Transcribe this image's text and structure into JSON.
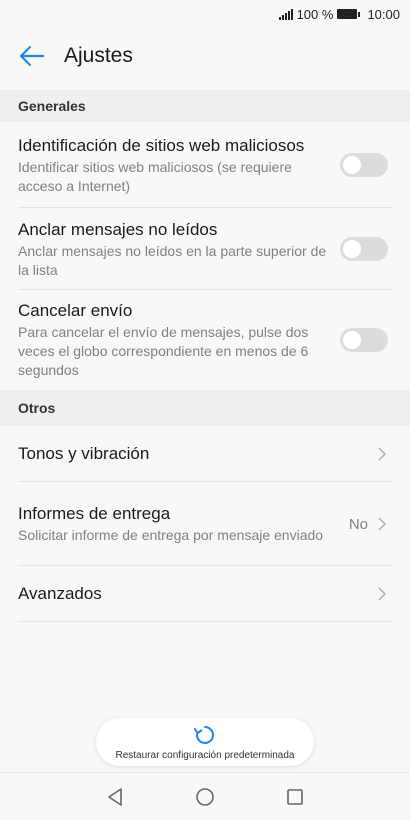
{
  "status_bar": {
    "battery": "100 %",
    "time": "10:00"
  },
  "header": {
    "title": "Ajustes"
  },
  "sections": [
    {
      "header": "Generales",
      "items": [
        {
          "title": "Identificación de sitios web maliciosos",
          "subtitle": "Identificar sitios web maliciosos (se requiere acceso a Internet)",
          "control": "toggle",
          "state": "off"
        },
        {
          "title": "Anclar mensajes no leídos",
          "subtitle": "Anclar mensajes no leídos en la parte superior de la lista",
          "control": "toggle",
          "state": "off"
        },
        {
          "title": "Cancelar envío",
          "subtitle": "Para cancelar el envío de mensajes, pulse dos veces el globo correspondiente en menos de 6 segundos",
          "control": "toggle",
          "state": "off"
        }
      ]
    },
    {
      "header": "Otros",
      "items": [
        {
          "title": "Tonos y vibración",
          "control": "chevron"
        },
        {
          "title": "Informes de entrega",
          "subtitle": "Solicitar informe de entrega por mensaje enviado",
          "value": "No",
          "control": "chevron"
        },
        {
          "title": "Avanzados",
          "control": "chevron"
        }
      ]
    }
  ],
  "restore": {
    "label": "Restaurar configuración predeterminada",
    "icon": "refresh-icon"
  },
  "colors": {
    "accent": "#1e88e5",
    "toggle_off": "#dcdcdc",
    "background": "#f8f8f8",
    "section_bg": "#efefef"
  }
}
